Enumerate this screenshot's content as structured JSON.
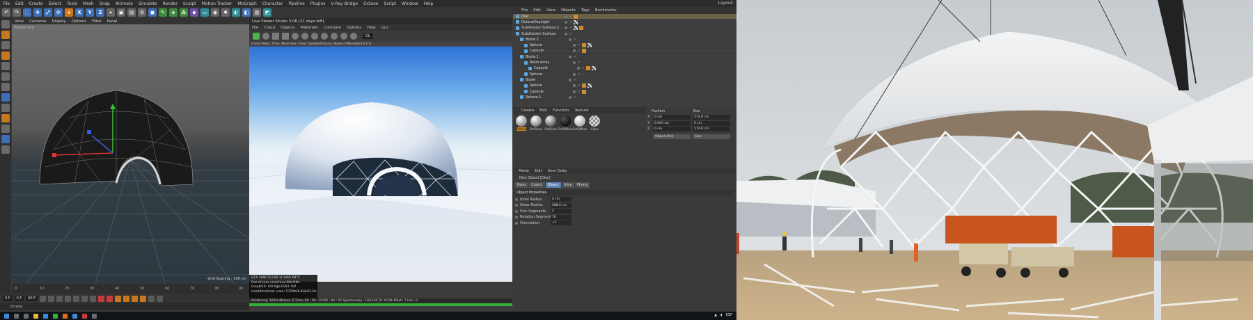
{
  "menubar": {
    "items": [
      "File",
      "Edit",
      "Create",
      "Select",
      "Tools",
      "Mesh",
      "Snap",
      "Animate",
      "Simulate",
      "Render",
      "Sculpt",
      "Motion Tracker",
      "MoGraph",
      "Character",
      "Pipeline",
      "Plugins",
      "V-Ray Bridge",
      "Octane",
      "Script",
      "Window",
      "Help"
    ],
    "layout_label": "Layout:"
  },
  "toolbar": {
    "axis_x": "X",
    "axis_y": "Y",
    "axis_z": "Z"
  },
  "viewport": {
    "menu": [
      "View",
      "Cameras",
      "Display",
      "Options",
      "Filter",
      "Panel"
    ],
    "label": "Perspective",
    "grid_spacing": "Grid Spacing : 100 cm"
  },
  "timeline": {
    "ticks": [
      "0",
      "10",
      "20",
      "30",
      "40",
      "50",
      "60",
      "70",
      "80",
      "90"
    ],
    "frame_start": "0 F",
    "frame_end": "90 F",
    "current": "0 F"
  },
  "status_c4d": "Octane:",
  "irv": {
    "title": "Live Viewer Studio 3.08 [21 days left]",
    "menu": [
      "File",
      "Cloud",
      "Objects",
      "Materials",
      "Compare",
      "Options",
      "Help",
      "Gui"
    ],
    "dropdown": "DL",
    "info": "Check Mess. Time, Mesh:Gen.Time: Update/Octane, Nodes:7(Movable):0  0.0",
    "stats": [
      "GTX 1080 Ti[7](0.1)    %9/1       68°C",
      "Out-of-core used/max:0Kb/0Kb",
      "Grey8/16: 0/0          Rgb32/64: 0/0",
      "Used/free/total vram: 537Mb/8.8Gb/11Gb"
    ],
    "status": "Rendering: 100%  Ms/sec: 0   Time: 00 : 00 : 02/00 : 00 : 02   Spp/maxspp: 128/128   Tri: 0/39k   Mesh: 7   Hair: 0"
  },
  "object_manager": {
    "menu": [
      "File",
      "Edit",
      "View",
      "Objects",
      "Tags",
      "Bookmarks"
    ],
    "objects": [
      "Disc",
      "OctaneDayLight",
      "Subdivision Surface.2",
      "Subdivision Surface",
      "Boole.2",
      "Sphere",
      "Capsule",
      "Boole.1",
      "Atom Array",
      "Capsule",
      "Sphere",
      "Boole",
      "Sphere",
      "Capsule",
      "Sphere.1"
    ]
  },
  "material_manager": {
    "menu": [
      "Create",
      "Edit",
      "Function",
      "Texture"
    ],
    "materials": [
      "Octane",
      "OctGloss",
      "OctGloss",
      "OctDiffuse",
      "OctDiffuse",
      "Glass"
    ]
  },
  "coordinates": {
    "head_pos": "Position",
    "head_size": "Size",
    "rows": [
      {
        "axis": "X",
        "pos": "0 cm",
        "size": "574.8 cm"
      },
      {
        "axis": "Y",
        "pos": "0.063 cm",
        "size": "0 cm"
      },
      {
        "axis": "Z",
        "pos": "0 cm",
        "size": "574.8 cm"
      }
    ],
    "mode": "Object (Rel)",
    "size_mode": "Size"
  },
  "attribute_manager": {
    "menu": [
      "Mode",
      "Edit",
      "User Data"
    ],
    "title": "Disc Object [Disc]",
    "tabs": [
      "Basic",
      "Coord.",
      "Object",
      "Slice",
      "Phong"
    ],
    "active_tab": "Object",
    "section": "Object Properties",
    "props": [
      {
        "label": "Inner Radius",
        "value": "0 cm"
      },
      {
        "label": "Outer Radius",
        "value": "288.6 cm"
      },
      {
        "label": "Disc Segments",
        "value": "4"
      },
      {
        "label": "Rotation Segments",
        "value": "70"
      },
      {
        "label": "Orientation",
        "value": "+Y"
      }
    ]
  },
  "taskbar": {
    "lang": "ESP"
  },
  "colors": {
    "c4d_bg": "#3b3b3b",
    "accent_orange": "#d4871f",
    "accent_blue": "#5c7fb4",
    "progress_green": "#2fb33a"
  }
}
